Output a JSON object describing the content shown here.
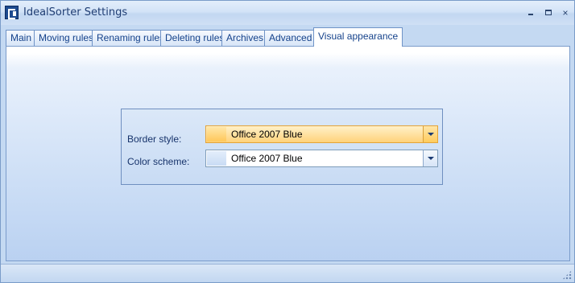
{
  "window": {
    "title": "IdealSorter Settings",
    "controls": {
      "minimize": "minimize",
      "maximize": "maximize",
      "close": "×"
    }
  },
  "tabs": [
    {
      "label": "Main",
      "active": false
    },
    {
      "label": "Moving rules",
      "active": false
    },
    {
      "label": "Renaming rules",
      "active": false
    },
    {
      "label": "Deleting rules",
      "active": false
    },
    {
      "label": "Archives",
      "active": false
    },
    {
      "label": "Advanced",
      "active": false
    },
    {
      "label": "Visual appearance",
      "active": true
    }
  ],
  "appearance": {
    "border_style": {
      "label": "Border style:",
      "value": "Office 2007 Blue"
    },
    "color_scheme": {
      "label": "Color scheme:",
      "value": "Office 2007 Blue"
    }
  },
  "icons": {
    "app": "app-icon",
    "dropdown": "chevron-down-icon",
    "grip": "resize-grip-icon"
  },
  "colors": {
    "accent": "#15428b",
    "panel": "#c9dcf5",
    "highlight": "#ffd27a"
  }
}
